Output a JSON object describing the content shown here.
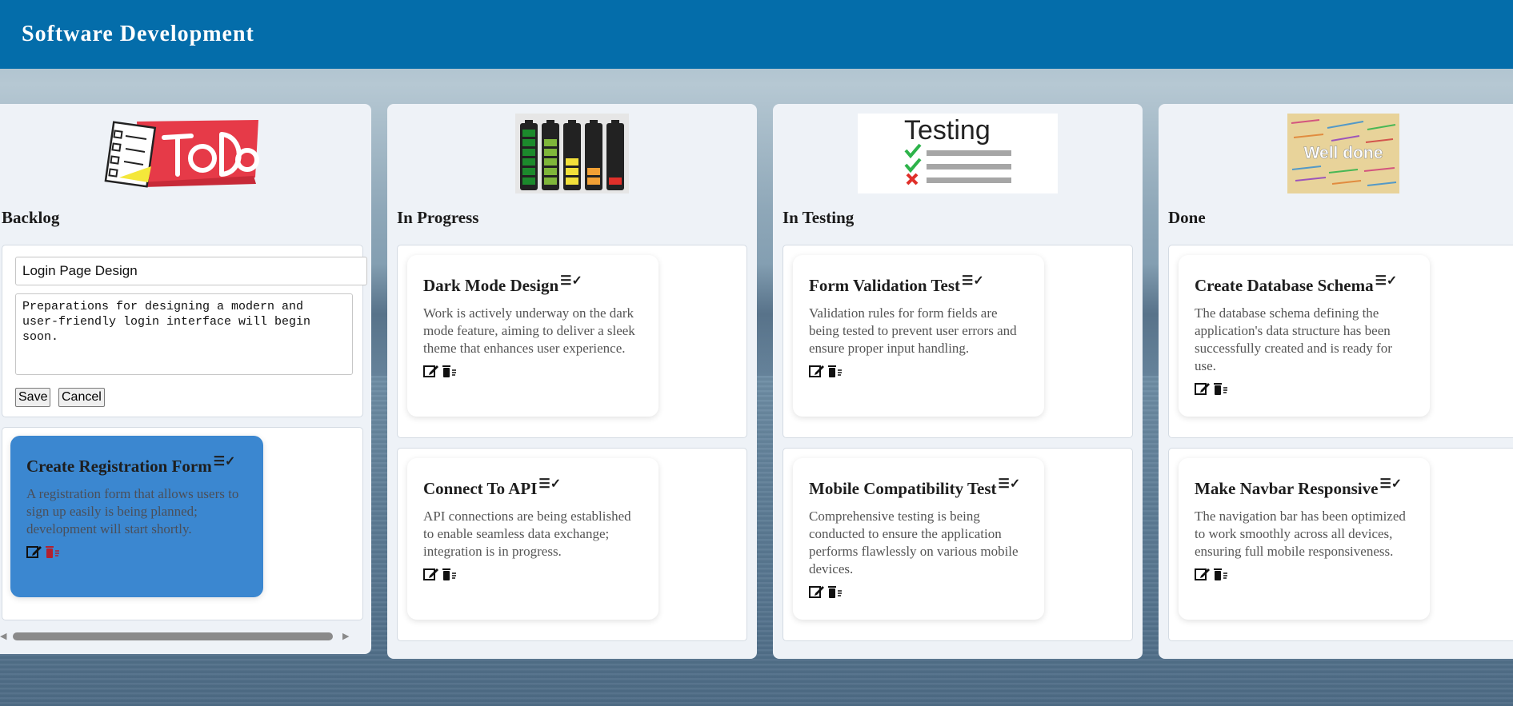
{
  "header": {
    "title": "Software Development"
  },
  "columns": [
    {
      "title": "Backlog",
      "image": "todo-logo",
      "form": {
        "title_value": "Login Page Design",
        "description_value": "Preparations for designing a modern and user-friendly login interface will begin soon.",
        "save_label": "Save",
        "cancel_label": "Cancel"
      },
      "cards": [
        {
          "title": "Create Registration Form",
          "description": "A registration form that allows users to sign up easily is being planned; development will start shortly.",
          "highlighted": true
        }
      ]
    },
    {
      "title": "In Progress",
      "image": "battery-levels",
      "cards": [
        {
          "title": "Dark Mode Design",
          "description": "Work is actively underway on the dark mode feature, aiming to deliver a sleek theme that enhances user experience."
        },
        {
          "title": "Connect To API",
          "description": "API connections are being established to enable seamless data exchange; integration is in progress."
        }
      ]
    },
    {
      "title": "In Testing",
      "image": "testing-checklist",
      "image_text": "Testing",
      "cards": [
        {
          "title": "Form Validation Test",
          "description": "Validation rules for form fields are being tested to prevent user errors and ensure proper input handling."
        },
        {
          "title": "Mobile Compatibility Test",
          "description": "Comprehensive testing is being conducted to ensure the application performs flawlessly on various mobile devices."
        }
      ]
    },
    {
      "title": "Done",
      "image": "well-done",
      "image_text": "Well done",
      "cards": [
        {
          "title": "Create Database Schema",
          "description": "The database schema defining the application's data structure has been successfully created and is ready for use."
        },
        {
          "title": "Make Navbar Responsive",
          "description": "The navigation bar has been optimized to work smoothly across all devices, ensuring full mobile responsiveness."
        }
      ]
    }
  ],
  "icons": {
    "list_check": "list-check-icon",
    "edit": "edit-icon",
    "delete": "trash-icon"
  },
  "colors": {
    "header": "#046daa",
    "column_bg": "#eef2f7",
    "active_card": "#3b87d0",
    "delete_active": "#c0392b"
  }
}
